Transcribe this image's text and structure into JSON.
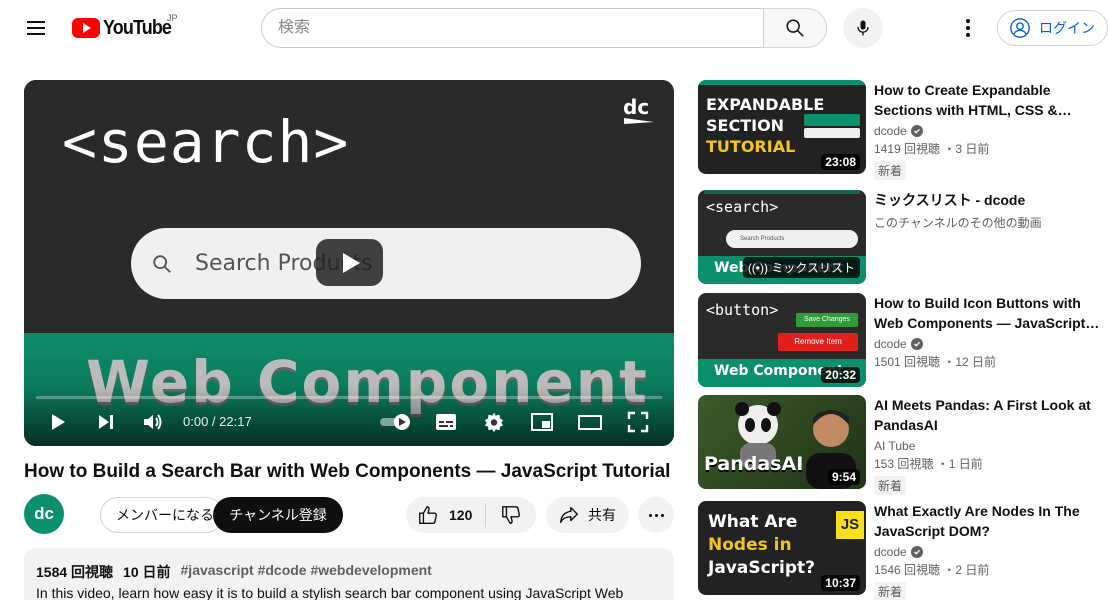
{
  "masthead": {
    "logo_text": "YouTube",
    "region": "JP",
    "search_placeholder": "検索",
    "login_label": "ログイン"
  },
  "player": {
    "thumb_title": "<search>",
    "thumb_search_text": "Search Products",
    "thumb_banner": "Web Component",
    "time": "0:00 / 22:17",
    "progress": 0
  },
  "video": {
    "title": "How to Build a Search Bar with Web Components — JavaScript Tutorial",
    "channel_initials": "dc",
    "member_label": "メンバーになる",
    "subscribe_label": "チャンネル登録",
    "like_count": "120",
    "share_label": "共有"
  },
  "description": {
    "views": "1584 回視聴",
    "age": "10 日前",
    "tags": "#javascript #dcode #webdevelopment",
    "text": "In this video, learn how easy it is to build a stylish search bar component using JavaScript Web"
  },
  "related": [
    {
      "title": "How to Create Expandable Sections with HTML, CSS & JavaScript",
      "channel": "dcode",
      "verified": true,
      "stats": "1419 回視聴 ・3 日前",
      "badge": "新着",
      "duration": "23:08",
      "thumb_lines": [
        "EXPANDABLE",
        "SECTION",
        "TUTORIAL"
      ]
    },
    {
      "title": "ミックスリスト - dcode",
      "channel": "このチャンネルのその他の動画",
      "verified": false,
      "mix_label": "ミックスリスト",
      "thumb_lines": [
        "<search>",
        "Search Products",
        "Web Component"
      ]
    },
    {
      "title": "How to Build Icon Buttons with Web Components — JavaScript Tutorial",
      "channel": "dcode",
      "verified": true,
      "stats": "1501 回視聴 ・12 日前",
      "duration": "20:32",
      "thumb_lines": [
        "<button>",
        "Save Changes",
        "Remove Item",
        "Web Component"
      ]
    },
    {
      "title": "AI Meets Pandas: A First Look at PandasAI",
      "channel": "AI Tube",
      "verified": false,
      "stats": "153 回視聴 ・1 日前",
      "badge": "新着",
      "duration": "9:54",
      "thumb_lines": [
        "PandasAI"
      ]
    },
    {
      "title": "What Exactly Are Nodes In The JavaScript DOM?",
      "channel": "dcode",
      "verified": true,
      "stats": "1546 回視聴 ・2 日前",
      "badge": "新着",
      "duration": "10:37",
      "thumb_lines": [
        "What Are",
        "Nodes in",
        "JavaScript?",
        "JS"
      ]
    }
  ],
  "colors": {
    "brand_red": "#ff0000",
    "accent_green": "#0b8f6c",
    "link_blue": "#065fd4"
  }
}
